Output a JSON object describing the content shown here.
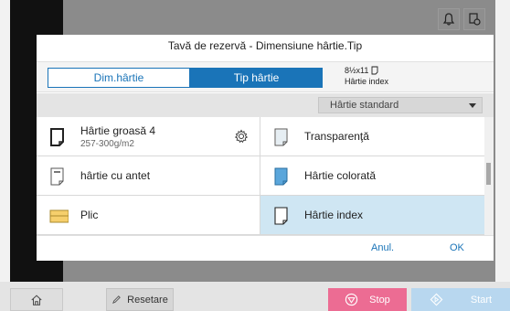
{
  "dialog": {
    "title": "Tavă de rezervă - Dimensiune hârtie.Tip",
    "tabs": {
      "paper_size": "Dim.hârtie",
      "paper_type": "Tip hârtie"
    },
    "current_paper": {
      "size": "8½x11",
      "type": "Hârtie index"
    },
    "dropdown": {
      "selected": "Hârtie standard"
    },
    "items": [
      {
        "label": "Hârtie groasă 4",
        "sub": "257-300g/m2",
        "icon": "thick-paper-icon"
      },
      {
        "label": "Transparenţă",
        "icon": "transparency-icon"
      },
      {
        "label": "hârtie cu antet",
        "icon": "letterhead-icon"
      },
      {
        "label": "Hârtie colorată",
        "icon": "colored-paper-icon"
      },
      {
        "label": "Plic",
        "icon": "envelope-icon"
      },
      {
        "label": "Hârtie index",
        "icon": "index-paper-icon"
      }
    ],
    "footer": {
      "cancel": "Anul.",
      "ok": "OK"
    }
  },
  "bottom_bar": {
    "reset": "Resetare",
    "stop": "Stop",
    "start": "Start"
  },
  "colors": {
    "accent": "#1a74b8",
    "selected_bg": "#cfe6f3",
    "stop": "#ec6c93",
    "start_disabled": "#b8d7ef",
    "envelope": "#f6cf6c",
    "colored_paper": "#5aa6db"
  }
}
